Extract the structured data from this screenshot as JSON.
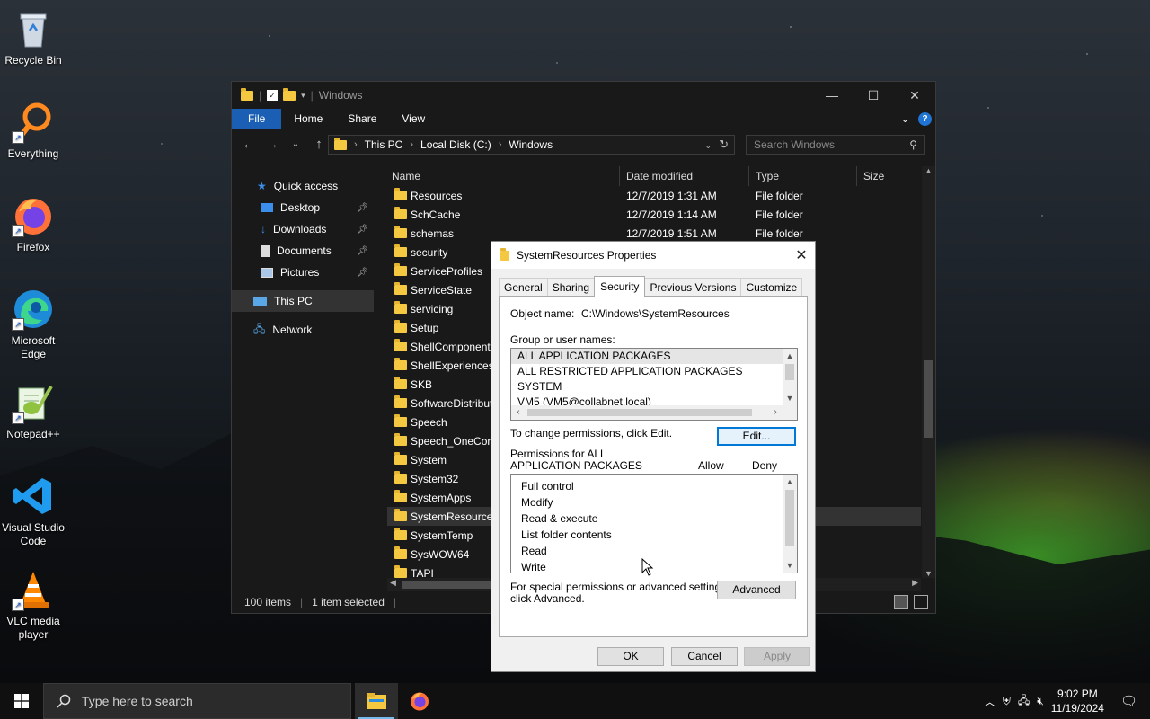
{
  "desktop": {
    "icons": [
      {
        "label": "Recycle Bin"
      },
      {
        "label": "Everything"
      },
      {
        "label": "Firefox"
      },
      {
        "label": "Microsoft Edge"
      },
      {
        "label": "Notepad++"
      },
      {
        "label": "Visual Studio Code"
      },
      {
        "label": "VLC media player"
      }
    ]
  },
  "explorer": {
    "title": "Windows",
    "ribbon": {
      "file": "File",
      "home": "Home",
      "share": "Share",
      "view": "View"
    },
    "address": {
      "crumbs": [
        "This PC",
        "Local Disk (C:)",
        "Windows"
      ]
    },
    "search_placeholder": "Search Windows",
    "nav": {
      "quick_access": "Quick access",
      "desktop": "Desktop",
      "downloads": "Downloads",
      "documents": "Documents",
      "pictures": "Pictures",
      "this_pc": "This PC",
      "network": "Network"
    },
    "columns": {
      "name": "Name",
      "date": "Date modified",
      "type": "Type",
      "size": "Size"
    },
    "rows": [
      {
        "name": "Resources",
        "date": "12/7/2019 1:31 AM",
        "type": "File folder"
      },
      {
        "name": "SchCache",
        "date": "12/7/2019 1:14 AM",
        "type": "File folder"
      },
      {
        "name": "schemas",
        "date": "12/7/2019 1:51 AM",
        "type": "File folder"
      },
      {
        "name": "security",
        "date": "",
        "type": ""
      },
      {
        "name": "ServiceProfiles",
        "date": "",
        "type": ""
      },
      {
        "name": "ServiceState",
        "date": "",
        "type": ""
      },
      {
        "name": "servicing",
        "date": "",
        "type": ""
      },
      {
        "name": "Setup",
        "date": "",
        "type": ""
      },
      {
        "name": "ShellComponents",
        "date": "",
        "type": ""
      },
      {
        "name": "ShellExperiences",
        "date": "",
        "type": ""
      },
      {
        "name": "SKB",
        "date": "",
        "type": ""
      },
      {
        "name": "SoftwareDistribution",
        "date": "",
        "type": ""
      },
      {
        "name": "Speech",
        "date": "",
        "type": ""
      },
      {
        "name": "Speech_OneCore",
        "date": "",
        "type": ""
      },
      {
        "name": "System",
        "date": "",
        "type": ""
      },
      {
        "name": "System32",
        "date": "",
        "type": ""
      },
      {
        "name": "SystemApps",
        "date": "",
        "type": ""
      },
      {
        "name": "SystemResources",
        "date": "",
        "type": ""
      },
      {
        "name": "SystemTemp",
        "date": "",
        "type": ""
      },
      {
        "name": "SysWOW64",
        "date": "",
        "type": ""
      },
      {
        "name": "TAPI",
        "date": "",
        "type": ""
      }
    ],
    "status": {
      "items": "100 items",
      "selected": "1 item selected"
    }
  },
  "dialog": {
    "title": "SystemResources Properties",
    "tabs": [
      "General",
      "Sharing",
      "Security",
      "Previous Versions",
      "Customize"
    ],
    "object_name_label": "Object name:",
    "object_name_value": "C:\\Windows\\SystemResources",
    "group_label": "Group or user names:",
    "groups": [
      "ALL APPLICATION PACKAGES",
      "ALL RESTRICTED APPLICATION PACKAGES",
      "SYSTEM",
      "VM5 (VM5@collabnet.local)"
    ],
    "change_text": "To change permissions, click Edit.",
    "edit_button": "Edit...",
    "perm_label_1": "Permissions for ALL",
    "perm_label_2": "APPLICATION PACKAGES",
    "allow": "Allow",
    "deny": "Deny",
    "permissions": [
      "Full control",
      "Modify",
      "Read & execute",
      "List folder contents",
      "Read",
      "Write"
    ],
    "special_1": "For special permissions or advanced settings,",
    "special_2": "click Advanced.",
    "advanced_button": "Advanced",
    "ok": "OK",
    "cancel": "Cancel",
    "apply": "Apply"
  },
  "taskbar": {
    "search_placeholder": "Type here to search",
    "time": "9:02 PM",
    "date": "11/19/2024"
  },
  "colors": {
    "accent": "#1a5fb4",
    "folder": "#f5c842",
    "focus": "#0078d7"
  }
}
